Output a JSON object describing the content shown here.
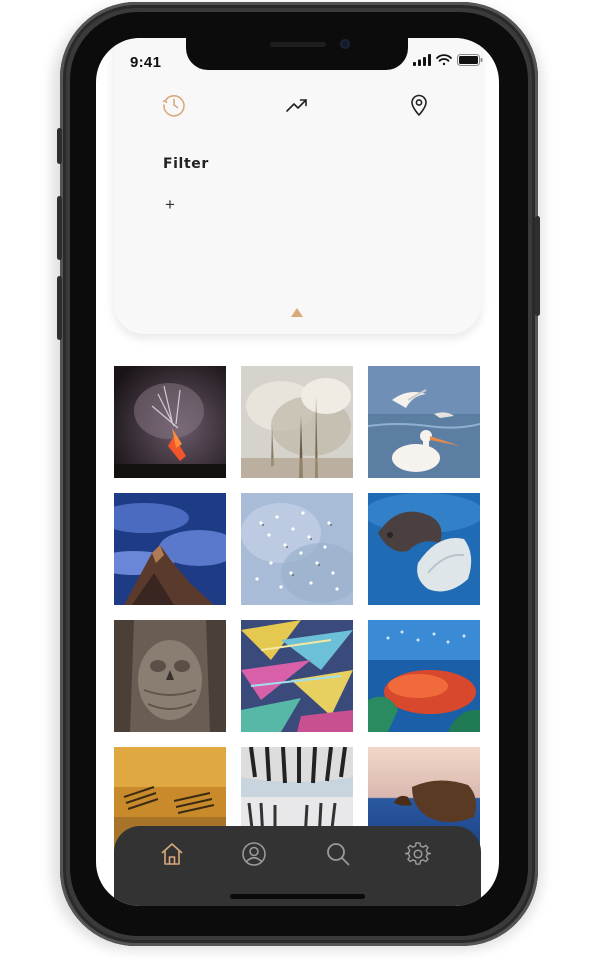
{
  "status_bar": {
    "time": "9:41"
  },
  "filter_panel": {
    "tabs": [
      {
        "icon": "clock-icon",
        "state": "active"
      },
      {
        "icon": "trending-icon",
        "state": "inactive"
      },
      {
        "icon": "location-pin-icon",
        "state": "inactive"
      }
    ],
    "title": "Filter",
    "add_label": "+"
  },
  "photos": [
    {
      "subject": "volcano-eruption"
    },
    {
      "subject": "misty-dead-trees"
    },
    {
      "subject": "pelicans"
    },
    {
      "subject": "mountain-peak-above-clouds"
    },
    {
      "subject": "birds-over-ice"
    },
    {
      "subject": "sea-lion-underwater"
    },
    {
      "subject": "camouflaged-owl"
    },
    {
      "subject": "crystal-macro"
    },
    {
      "subject": "coral-reef-fish"
    },
    {
      "subject": "zebras-golden-light"
    },
    {
      "subject": "zebras-under-zebra"
    },
    {
      "subject": "animal-at-sunset-sea"
    }
  ],
  "bottom_nav": {
    "items": [
      {
        "icon": "home-icon",
        "state": "active"
      },
      {
        "icon": "profile-icon",
        "state": "inactive"
      },
      {
        "icon": "search-icon",
        "state": "inactive"
      },
      {
        "icon": "gear-icon",
        "state": "inactive"
      }
    ]
  },
  "colors": {
    "accent": "#d9a87b",
    "nav_bg": "#333333",
    "panel_bg": "#f8f8f8",
    "icon_inactive": "#9a9a9a"
  }
}
